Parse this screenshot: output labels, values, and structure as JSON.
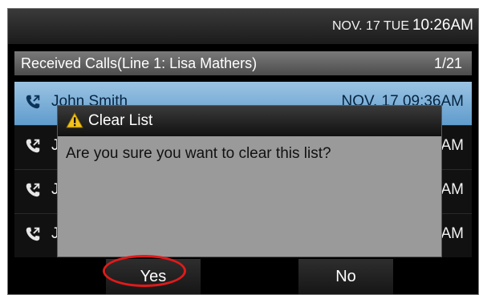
{
  "status_bar": {
    "date": "NOV. 17 TUE",
    "time": "10:26AM"
  },
  "list": {
    "title": "Received Calls(Line 1: Lisa Mathers)",
    "count": "1/21",
    "rows": [
      {
        "name": "John Smith",
        "time": "NOV. 17 09:36AM",
        "selected": true
      },
      {
        "name": "J",
        "time": "AM"
      },
      {
        "name": "J",
        "time": "AM"
      },
      {
        "name": "J",
        "time": "AM"
      }
    ]
  },
  "dialog": {
    "title": "Clear List",
    "message": "Are you sure you want to clear this list?"
  },
  "softkeys": {
    "yes": "Yes",
    "no": "No"
  },
  "icons": {
    "phone": "phone-incoming-icon",
    "warning": "warning-icon"
  },
  "colors": {
    "selected_row": "#6aa6d6",
    "dialog_bg": "#9a9a9a",
    "annotation": "#e11a1a"
  }
}
